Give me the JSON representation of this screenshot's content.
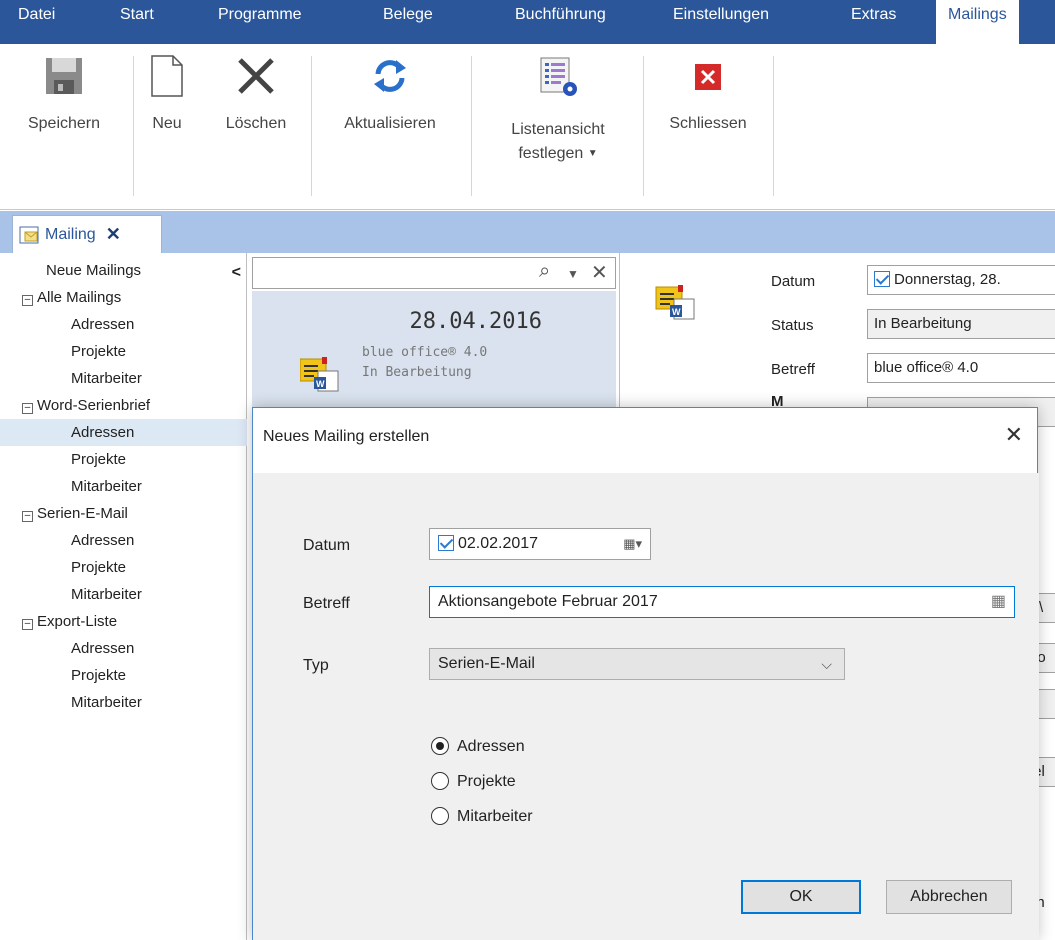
{
  "menu": {
    "items": [
      "Datei",
      "Start",
      "Programme",
      "Belege",
      "Buchführung",
      "Einstellungen",
      "Extras",
      "Mailings"
    ],
    "active": "Mailings"
  },
  "ribbon": {
    "save": "Speichern",
    "new": "Neu",
    "delete": "Löschen",
    "refresh": "Aktualisieren",
    "listview_line1": "Listenansicht",
    "listview_line2": "festlegen",
    "close": "Schliessen"
  },
  "doc_tab": {
    "label": "Mailing",
    "close": "✕"
  },
  "tree": {
    "collapse": "<",
    "items": [
      {
        "label": "Neue Mailings",
        "level": 0
      },
      {
        "label": "Alle Mailings",
        "level": 1
      },
      {
        "label": "Adressen",
        "level": 2
      },
      {
        "label": "Projekte",
        "level": 2
      },
      {
        "label": "Mitarbeiter",
        "level": 2
      },
      {
        "label": "Word-Serienbrief",
        "level": 1
      },
      {
        "label": "Adressen",
        "level": 2
      },
      {
        "label": "Projekte",
        "level": 2
      },
      {
        "label": "Mitarbeiter",
        "level": 2
      },
      {
        "label": "Serien-E-Mail",
        "level": 1
      },
      {
        "label": "Adressen",
        "level": 2
      },
      {
        "label": "Projekte",
        "level": 2
      },
      {
        "label": "Mitarbeiter",
        "level": 2
      },
      {
        "label": "Export-Liste",
        "level": 1
      },
      {
        "label": "Adressen",
        "level": 2
      },
      {
        "label": "Projekte",
        "level": 2
      },
      {
        "label": "Mitarbeiter",
        "level": 2
      }
    ]
  },
  "list": {
    "card": {
      "date": "28.04.2016",
      "subject": "blue office® 4.0",
      "status": "In Bearbeitung"
    }
  },
  "detail": {
    "datum_label": "Datum",
    "datum_value": "Donnerstag, 28.",
    "status_label": "Status",
    "status_value": "In Bearbeitung",
    "betreff_label": "Betreff",
    "betreff_value": "blue office® 4.0",
    "partial_label": "M",
    "partial_1": "E\\",
    "partial_2": "do",
    "partial_3": "x",
    "partial_4": "tel",
    "partial_5": "en"
  },
  "dialog": {
    "title": "Neues Mailing erstellen",
    "datum_label": "Datum",
    "datum_value": "02.02.2017",
    "betreff_label": "Betreff",
    "betreff_value": "Aktionsangebote Februar 2017",
    "typ_label": "Typ",
    "typ_value": "Serien-E-Mail",
    "radios": [
      "Adressen",
      "Projekte",
      "Mitarbeiter"
    ],
    "selected_radio": "Adressen",
    "ok": "OK",
    "cancel": "Abbrechen"
  },
  "colors": {
    "accent": "#2b579a",
    "tabbar": "#a9c3e8",
    "selection": "#dde8f5"
  }
}
